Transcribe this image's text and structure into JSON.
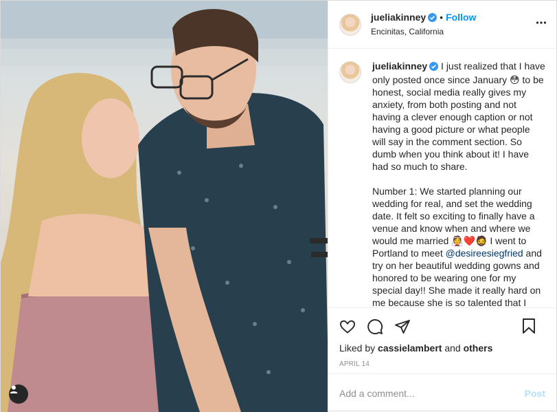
{
  "post": {
    "username": "jueliakinney",
    "follow_label": "Follow",
    "separator": "•",
    "location": "Encinitas, California",
    "caption_username": "jueliakinney",
    "caption_part1": " I just realized that I have only posted once since January 😳 to be honest, social media really gives my anxiety, from both posting and not having a clever enough caption or not having a good picture or what people will say in the comment section. So dumb when you think about it! I have had so much to share.\n\nNumber 1: We started planning our wedding for real, and set the wedding date. It felt so exciting to finally have a venue and know when and where we would me married 👰❤️🧔 I went to Portland to meet ",
    "caption_mention": "@desireesiegfried",
    "caption_part2": " and try on her beautiful wedding gowns and honored to be wearing one for my special day!! She made it really hard on me because she is so talented that I",
    "liked_by_prefix": "Liked by ",
    "liked_by_user": "cassielambert",
    "liked_by_and": " and ",
    "liked_by_others": "others",
    "date": "APRIL 14",
    "comment_placeholder": "Add a comment...",
    "post_label": "Post"
  },
  "icons": {
    "more": "more-options-icon",
    "verified": "verified-badge-icon",
    "like": "heart-icon",
    "comment": "comment-bubble-icon",
    "share": "paper-plane-icon",
    "save": "bookmark-icon",
    "tags": "user-tag-icon"
  },
  "colors": {
    "link_blue": "#0095f6",
    "mention": "#00376b",
    "muted": "#8e8e8e",
    "post_disabled": "#b2dffc"
  }
}
